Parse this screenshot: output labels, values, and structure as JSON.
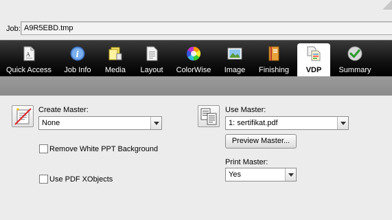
{
  "job": {
    "label": "Job:",
    "value": "A9R5EBD.tmp"
  },
  "tabs": [
    {
      "label": "Quick Access",
      "icon": "document-icon"
    },
    {
      "label": "Job Info",
      "icon": "info-icon"
    },
    {
      "label": "Media",
      "icon": "media-icon"
    },
    {
      "label": "Layout",
      "icon": "layout-icon"
    },
    {
      "label": "ColorWise",
      "icon": "colorwheel-icon"
    },
    {
      "label": "Image",
      "icon": "image-icon"
    },
    {
      "label": "Finishing",
      "icon": "finishing-icon"
    },
    {
      "label": "VDP",
      "icon": "vdp-icon"
    },
    {
      "label": "Summary",
      "icon": "checkmark-icon"
    }
  ],
  "active_tab": "VDP",
  "vdp": {
    "create_master_label": "Create Master:",
    "create_master_value": "None",
    "remove_white_ppt_label": "Remove White PPT Background",
    "remove_white_ppt_checked": false,
    "use_pdf_xobjects_label": "Use PDF XObjects",
    "use_pdf_xobjects_checked": false,
    "use_master_label": "Use Master:",
    "use_master_value": "1: sertifikat.pdf",
    "preview_master_label": "Preview Master...",
    "print_master_label": "Print Master:",
    "print_master_value": "Yes"
  }
}
